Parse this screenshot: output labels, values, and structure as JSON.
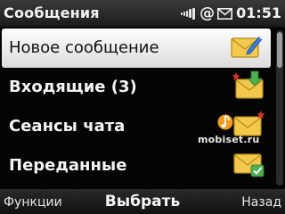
{
  "status_bar": {
    "title": "Сообщения",
    "at_symbol": "@",
    "time": "01:51",
    "icons": [
      "signal-icon",
      "at-icon",
      "envelope-icon"
    ]
  },
  "menu": {
    "items": [
      {
        "label": "Новое сообщение",
        "icon": "new-message-icon",
        "selected": true
      },
      {
        "label": "Входящие (3)",
        "icon": "inbox-icon",
        "selected": false
      },
      {
        "label": "Сеансы чата",
        "icon": "chat-sessions-icon",
        "selected": false
      },
      {
        "label": "Переданные",
        "icon": "sent-icon",
        "selected": false
      }
    ]
  },
  "scrollbar": {
    "position_fraction": 0.0
  },
  "watermark": {
    "text": "mobiset.ru"
  },
  "softkeys": {
    "left": "Функции",
    "center": "Выбрать",
    "right": "Назад"
  },
  "colors": {
    "envelope": "#f2c94c",
    "selection": "#f0f0f0",
    "accent_red": "#e03030",
    "accent_green": "#4caf50"
  }
}
